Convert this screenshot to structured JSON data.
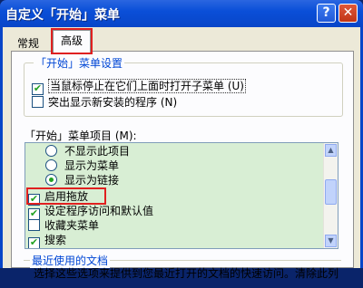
{
  "window": {
    "title": "自定义「开始」菜单",
    "help_label": "?",
    "close_label": "✕"
  },
  "tabs": [
    {
      "label": "常规"
    },
    {
      "label": "高级"
    }
  ],
  "settings_group": {
    "legend": "「开始」菜单设置",
    "options": [
      {
        "label": "当鼠标停止在它们上面时打开子菜单 (U)",
        "checked": true
      },
      {
        "label": "突出显示新安装的程序 (N)",
        "checked": false
      }
    ]
  },
  "items_list": {
    "label": "「开始」菜单项目 (M):",
    "rows": [
      {
        "kind": "radio",
        "label": "不显示此项目",
        "selected": false
      },
      {
        "kind": "radio",
        "label": "显示为菜单",
        "selected": false
      },
      {
        "kind": "radio",
        "label": "显示为链接",
        "selected": true
      },
      {
        "kind": "checkbox",
        "label": "启用拖放",
        "checked": true
      },
      {
        "kind": "checkbox",
        "label": "设定程序访问和默认值",
        "checked": true
      },
      {
        "kind": "checkbox",
        "label": "收藏夹菜单",
        "checked": false
      },
      {
        "kind": "checkbox",
        "label": "搜索",
        "checked": true
      }
    ]
  },
  "recent_group": {
    "legend": "最近使用的文档",
    "description": "选择这些选项来提供到您最近打开的文档的快速访问。清除此列"
  },
  "colors": {
    "highlight": "#e02020",
    "accent": "#0046d5",
    "check": "#21a121"
  }
}
